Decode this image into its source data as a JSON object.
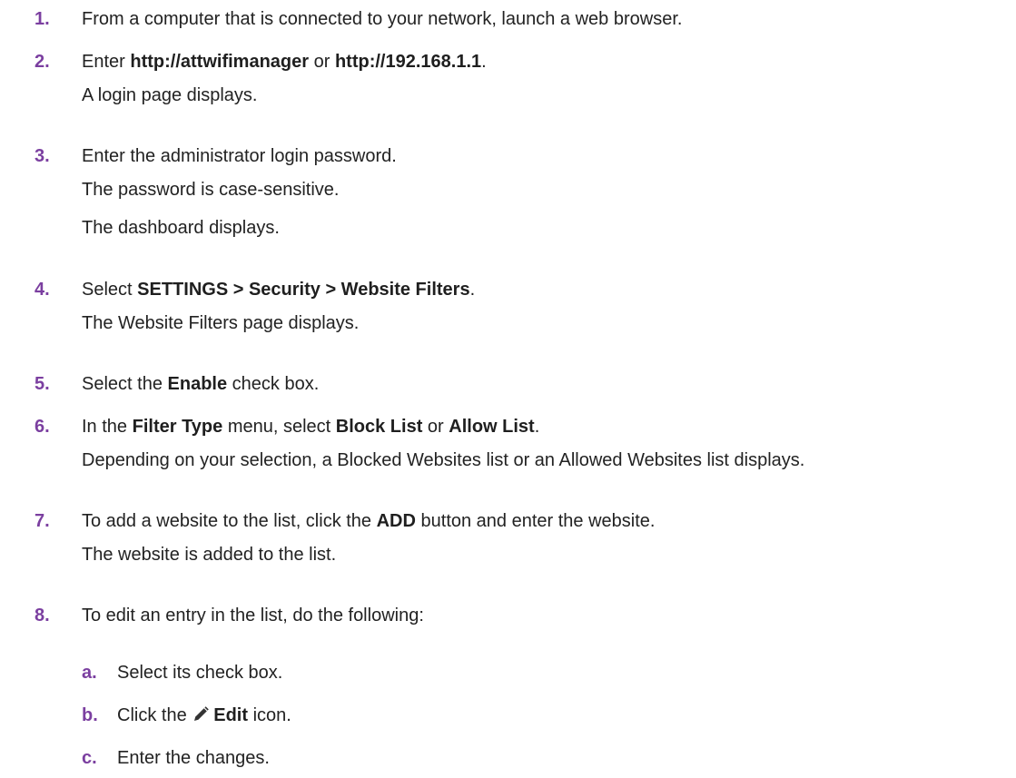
{
  "steps": [
    {
      "num": "1.",
      "text": "From a computer that is connected to your network, launch a web browser."
    },
    {
      "num": "2.",
      "pre": "Enter ",
      "b1": "http://attwifimanager",
      "mid": " or ",
      "b2": "http://192.168.1.1",
      "post": ".",
      "note": "A login page displays."
    },
    {
      "num": "3.",
      "text": "Enter the administrator login password.",
      "note1": "The password is case-sensitive.",
      "note2": "The dashboard displays."
    },
    {
      "num": "4.",
      "pre": "Select ",
      "b1": "SETTINGS > Security > Website Filters",
      "post": ".",
      "note": "The Website Filters page displays."
    },
    {
      "num": "5.",
      "pre": "Select the ",
      "b1": "Enable",
      "post": " check box."
    },
    {
      "num": "6.",
      "pre": "In the ",
      "b1": "Filter Type",
      "mid": " menu, select ",
      "b2": "Block List",
      "mid2": " or ",
      "b3": "Allow List",
      "post": ".",
      "note": "Depending on your selection, a Blocked Websites list or an Allowed Websites list displays."
    },
    {
      "num": "7.",
      "pre": "To add a website to the list, click the ",
      "b1": "ADD",
      "post": " button and enter the website.",
      "note": "The website is added to the list."
    },
    {
      "num": "8.",
      "text": "To edit an entry in the list, do the following:"
    }
  ],
  "substeps": [
    {
      "num": "a.",
      "text": "Select its check box."
    },
    {
      "num": "b.",
      "pre": "Click the ",
      "icon": "pencil-icon",
      "b1": "Edit",
      "post": " icon."
    },
    {
      "num": "c.",
      "text": "Enter the changes."
    }
  ],
  "colors": {
    "accent": "#7b3fa0",
    "text": "#222222"
  }
}
